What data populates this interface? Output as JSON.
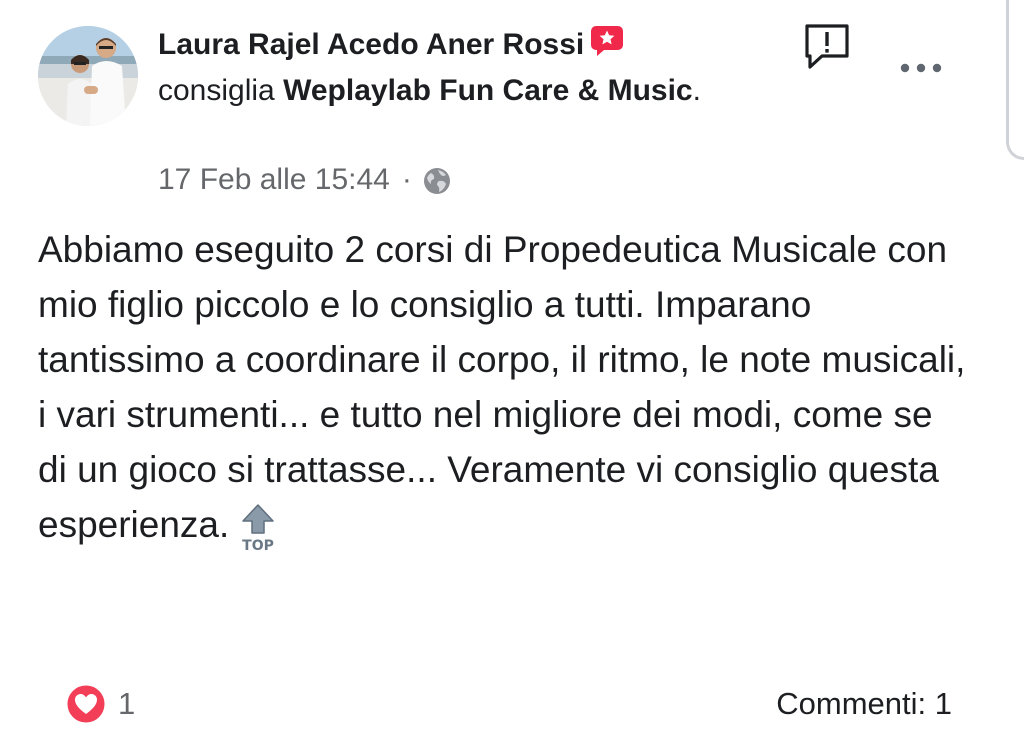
{
  "post": {
    "author": "Laura Rajel Acedo Aner Rossi",
    "verb": "consiglia",
    "page_name": "Weplaylab Fun Care & Music",
    "page_suffix": ".",
    "timestamp": "17 Feb alle 15:44",
    "separator": "·",
    "privacy_icon": "globe-icon",
    "body": "Abbiamo eseguito 2 corsi di Propedeutica Musicale con mio figlio piccolo e lo consiglio a tutti. Imparano tantissimo a coordinare il corpo, il ritmo, le note musicali, i vari strumenti... e tutto nel migliore dei modi, come se di un gioco si trattasse... Veramente vi consiglio questa esperienza.",
    "body_emoji": "TOP",
    "recommend_badge_icon": "recommend-star-icon"
  },
  "reactions": {
    "icon": "love-icon",
    "count": "1"
  },
  "comments": {
    "label": "Commenti: 1"
  },
  "colors": {
    "recommend_badge": "#f02849",
    "love_reaction": "#f33e58",
    "secondary_text": "#65676b",
    "primary_text": "#1c1e21"
  }
}
